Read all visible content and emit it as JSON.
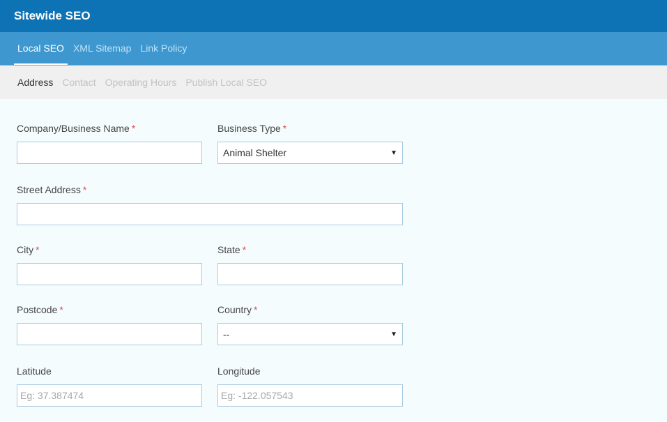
{
  "header": {
    "title": "Sitewide SEO"
  },
  "tabs": [
    {
      "label": "Local SEO",
      "active": true
    },
    {
      "label": "XML Sitemap",
      "active": false
    },
    {
      "label": "Link Policy",
      "active": false
    }
  ],
  "subtabs": [
    {
      "label": "Address",
      "active": true
    },
    {
      "label": "Contact",
      "active": false
    },
    {
      "label": "Operating Hours",
      "active": false
    },
    {
      "label": "Publish Local SEO",
      "active": false
    }
  ],
  "form": {
    "required_marker": "*",
    "company_name": {
      "label": "Company/Business Name",
      "value": ""
    },
    "business_type": {
      "label": "Business Type",
      "value": "Animal Shelter"
    },
    "street_address": {
      "label": "Street Address",
      "value": ""
    },
    "city": {
      "label": "City",
      "value": ""
    },
    "state": {
      "label": "State",
      "value": ""
    },
    "postcode": {
      "label": "Postcode",
      "value": ""
    },
    "country": {
      "label": "Country",
      "value": "--"
    },
    "latitude": {
      "label": "Latitude",
      "value": "",
      "placeholder": "Eg: 37.387474"
    },
    "longitude": {
      "label": "Longitude",
      "value": "",
      "placeholder": "Eg: -122.057543"
    }
  },
  "icons": {
    "select_caret": "caret-down-icon"
  },
  "colors": {
    "header_bg": "#0e73b4",
    "tabs_bg": "#3e98cf",
    "subtabs_bg": "#f0f0f0",
    "required": "#e0464c",
    "input_border": "#a9cbe0"
  }
}
